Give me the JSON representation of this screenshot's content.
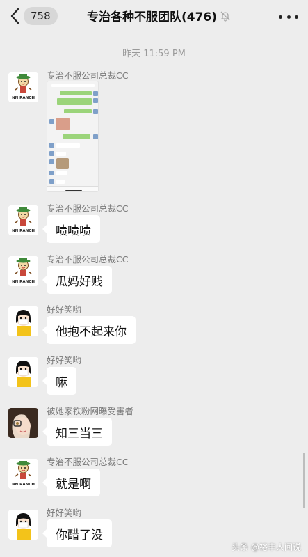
{
  "header": {
    "unread_count": "758",
    "title": "专治各种不服团队(476)"
  },
  "timestamp": "昨天 11:59 PM",
  "messages": [
    {
      "sender": "专治不服公司总裁CC",
      "type": "image",
      "avatar": "nn-ranch-logo-avatar"
    },
    {
      "sender": "专治不服公司总裁CC",
      "type": "text",
      "text": "啧啧啧",
      "avatar": "nn-ranch-logo-avatar"
    },
    {
      "sender": "专治不服公司总裁CC",
      "type": "text",
      "text": "瓜妈好贱",
      "avatar": "nn-ranch-logo-avatar"
    },
    {
      "sender": "好好笑哟",
      "type": "text",
      "text": "他抱不起来你",
      "avatar": "cartoon-girl-avatar"
    },
    {
      "sender": "好好笑哟",
      "type": "text",
      "text": "嘛",
      "avatar": "cartoon-girl-avatar"
    },
    {
      "sender": "被她家铁粉网曝受害者",
      "type": "text",
      "text": "知三当三",
      "avatar": "photo-girl-avatar"
    },
    {
      "sender": "专治不服公司总裁CC",
      "type": "text",
      "text": "就是啊",
      "avatar": "nn-ranch-logo-avatar"
    },
    {
      "sender": "好好笑哟",
      "type": "text",
      "text": "你醋了没",
      "avatar": "cartoon-girl-avatar"
    }
  ],
  "avatar_logo_text": "NN RANCH",
  "watermark": "头条 @裕丰人间说",
  "colors": {
    "background": "#ededed",
    "bubble": "#ffffff",
    "wechat_green": "#95ec69"
  }
}
